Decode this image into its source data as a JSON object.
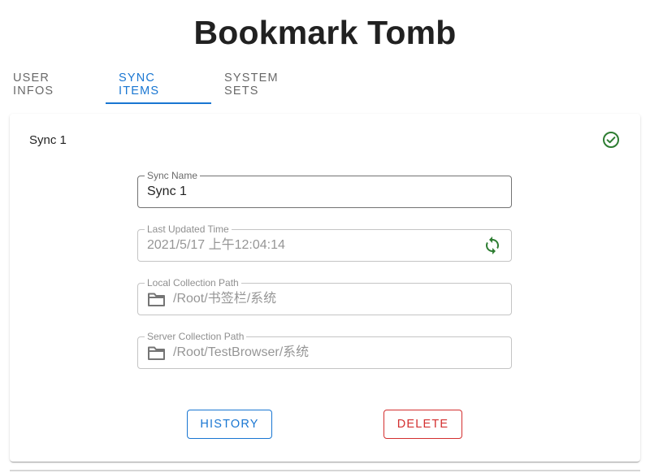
{
  "header": {
    "title": "Bookmark Tomb"
  },
  "tabs": [
    {
      "label": "USER INFOS"
    },
    {
      "label": "SYNC ITEMS",
      "active": true
    },
    {
      "label": "SYSTEM SETS"
    }
  ],
  "sync_card": {
    "title": "Sync 1",
    "status_icon": "check-circle-outline-icon",
    "fields": {
      "sync_name": {
        "label": "Sync Name",
        "value": "Sync 1"
      },
      "last_updated": {
        "label": "Last Updated Time",
        "value": "2021/5/17 上午12:04:14",
        "icon": "refresh-icon"
      },
      "local_path": {
        "label": "Local Collection Path",
        "value": "/Root/书签栏/系统",
        "icon": "folder-icon"
      },
      "server_path": {
        "label": "Server Collection Path",
        "value": "/Root/TestBrowser/系统",
        "icon": "folder-icon"
      }
    },
    "buttons": {
      "history": "HISTORY",
      "delete": "DELETE"
    }
  },
  "colors": {
    "primary": "#1976d2",
    "error": "#d32f2f",
    "success": "#2e7d32"
  }
}
